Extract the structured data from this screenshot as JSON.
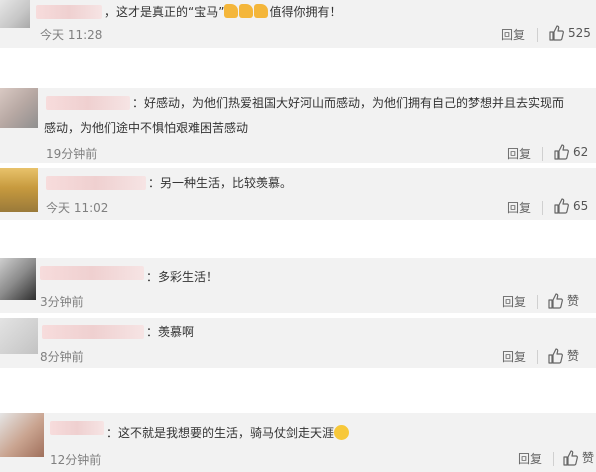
{
  "comments": [
    {
      "text": "，这才是真正的“宝马”",
      "text_after": "值得你拥有！",
      "emoji": [
        "thumbs-up",
        "thumbs-up",
        "thumbs-up"
      ],
      "time": "今天 11:28",
      "reply_label": "回复",
      "like_count": "525"
    },
    {
      "text_line1": "：好感动，为他们热爱祖国大好河山而感动，为他们拥有自己的梦想并且去实现而",
      "text_line2": "感动，为他们途中不惧怕艰难困苦感动",
      "time": "19分钟前",
      "reply_label": "回复",
      "like_count": "62"
    },
    {
      "text": "：另一种生活，比较羡慕。",
      "time": "今天 11:02",
      "reply_label": "回复",
      "like_count": "65"
    },
    {
      "text": "：多彩生活！",
      "time": "3分钟前",
      "reply_label": "回复",
      "like_label": "赞"
    },
    {
      "text": "：羡慕啊",
      "time": "8分钟前",
      "reply_label": "回复",
      "like_label": "赞"
    },
    {
      "text": "：这不就是我想要的生活，骑马仗剑走天涯",
      "emoji": [
        "smiling-face"
      ],
      "time": "12分钟前",
      "reply_label": "回复",
      "like_label": "赞"
    }
  ]
}
